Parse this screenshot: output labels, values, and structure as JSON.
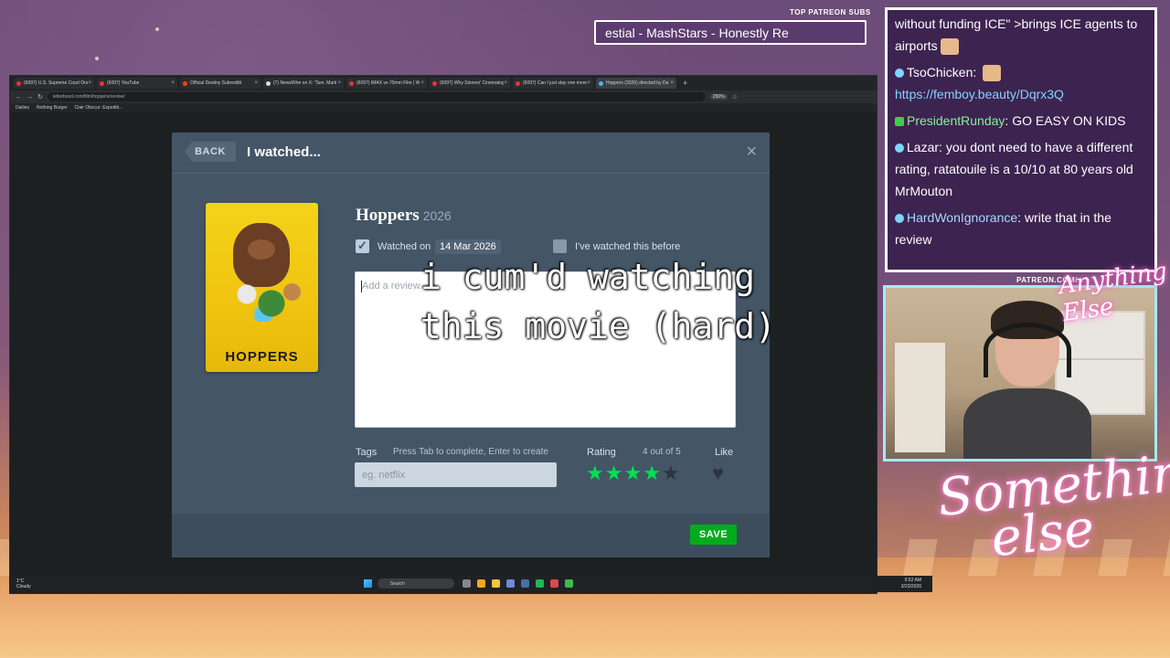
{
  "ticker": {
    "label": "TOP PATREON SUBS",
    "text": "estial - MashStars - Honestly Re"
  },
  "browser": {
    "tabs": [
      "(6097) U.S. Supreme Court Oral",
      "(6097) YouTube",
      "Official Destiny Subreddit",
      "(7) NewsWire on X: \"Sen. Marti",
      "(6097) IMAX vs 70mm Film | W",
      "(6097) Why Sinners' Cinematog",
      "(6097) Can I just stay one more",
      "Hoppers (2026) directed by Da"
    ],
    "url": "letterboxd.com/film/hoppers/review/",
    "zoom": "250%",
    "bookmarks": [
      "Dailies",
      "Nothing Burger",
      "Clair Obscur: Expediti..."
    ]
  },
  "modal": {
    "back_label": "BACK",
    "title": "I watched...",
    "close_label": "×",
    "film_title": "Hoppers",
    "film_year": "2026",
    "poster_title": "HOPPERS",
    "watched_on_label": "Watched on",
    "watched_date": "14 Mar 2026",
    "watched_before_label": "I've watched this before",
    "review_placeholder": "Add a review...",
    "tags_label": "Tags",
    "tags_hint": "Press Tab to complete, Enter to create",
    "tags_placeholder": "eg. netflix",
    "rating_label": "Rating",
    "rating_text": "4 out of 5",
    "rating_value": 4,
    "rating_max": 5,
    "like_label": "Like",
    "save_label": "SAVE",
    "accent": "#00e054"
  },
  "overlay_caption": "i cum'd watching\nthis movie (hard)",
  "taskbar": {
    "weather_temp": "1°C",
    "weather_desc": "Cloudy",
    "search_label": "Search",
    "time": "9:52 AM",
    "date": "3/23/2026"
  },
  "chat": [
    {
      "user": "",
      "text": "without funding ICE\" >brings ICE agents to airports"
    },
    {
      "user": "TsoChicken",
      "text": "https://femboy.beauty/Dqrx3Q"
    },
    {
      "user": "PresidentRunday",
      "text": "GO EASY ON KIDS"
    },
    {
      "user": "Lazar",
      "text": "you dont need to have a different rating, ratatouile is a 10/10 at 80 years old MrMouton"
    },
    {
      "user": "HardWonIgnorance",
      "text": "write that in the review"
    }
  ],
  "webcam": {
    "patreon_label": "PATREON.COM/",
    "neon_small": "Anything Else",
    "neon_big": "Something\n   else"
  }
}
